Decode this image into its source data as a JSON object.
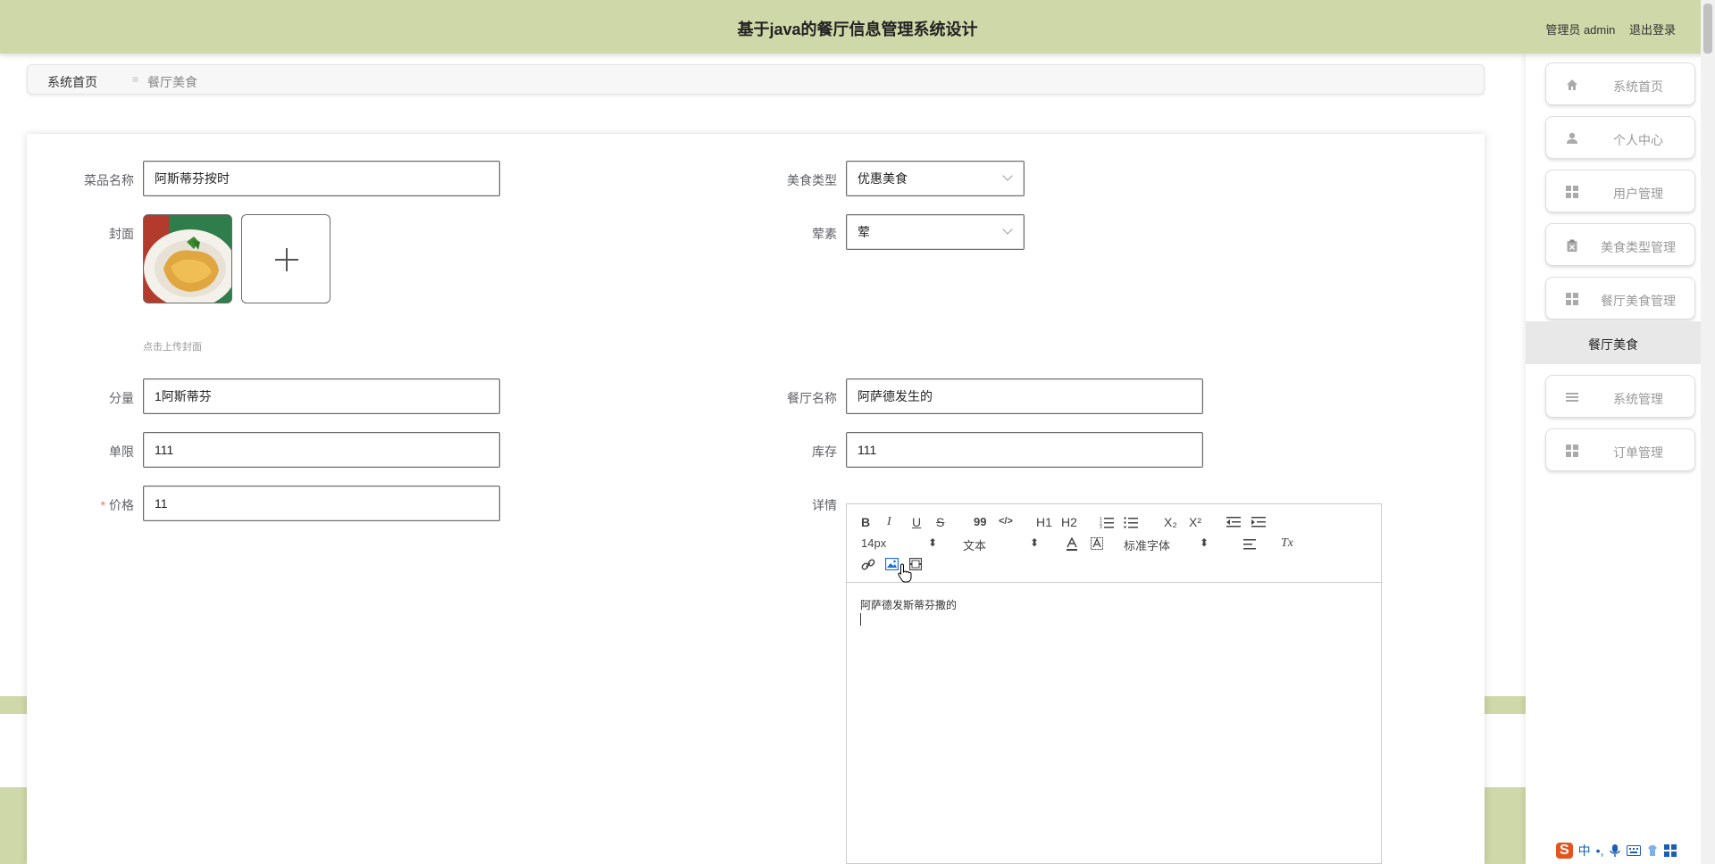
{
  "header": {
    "title": "基于java的餐厅信息管理系统设计",
    "user_label": "管理员 admin",
    "logout_label": "退出登录"
  },
  "breadcrumb": {
    "home": "系统首页",
    "separator": "≡",
    "current": "餐厅美食"
  },
  "form": {
    "dish_name": {
      "label": "菜品名称",
      "value": "阿斯蒂芬按时"
    },
    "food_type": {
      "label": "美食类型",
      "value": "优惠美食"
    },
    "cover": {
      "label": "封面",
      "hint": "点击上传封面"
    },
    "meat_veg": {
      "label": "荤素",
      "value": "荤"
    },
    "portion": {
      "label": "分量",
      "value": "1阿斯蒂芬"
    },
    "restaurant": {
      "label": "餐厅名称",
      "value": "阿萨德发生的"
    },
    "limit": {
      "label": "单限",
      "value": "111"
    },
    "stock": {
      "label": "库存",
      "value": "111"
    },
    "price": {
      "label": "价格",
      "required_mark": "*",
      "value": "11"
    },
    "detail": {
      "label": "详情",
      "content": "阿萨德发斯蒂芬撒的"
    }
  },
  "editor_toolbar": {
    "bold": "B",
    "italic": "I",
    "underline": "U",
    "strike": "S",
    "quote": "99",
    "code": "</>",
    "h1": "H1",
    "h2": "H2",
    "subscript": "X₂",
    "superscript": "X²",
    "font_size": "14px",
    "header_select": "文本",
    "font_family": "标准字体",
    "clear": "Tx",
    "spin": "⬍"
  },
  "sidebar": {
    "items": [
      {
        "label": "系统首页",
        "icon": "home-icon"
      },
      {
        "label": "个人中心",
        "icon": "user-icon"
      },
      {
        "label": "用户管理",
        "icon": "grid-icon"
      },
      {
        "label": "美食类型管理",
        "icon": "clipboard-icon"
      },
      {
        "label": "餐厅美食管理",
        "icon": "grid-icon"
      },
      {
        "label": "系统管理",
        "icon": "menu-icon"
      },
      {
        "label": "订单管理",
        "icon": "grid-icon"
      }
    ],
    "active": "餐厅美食"
  },
  "ime": {
    "logo": "S",
    "lang": "中",
    "punct": "•,"
  },
  "colors": {
    "header_bg": "#cfd8a8",
    "required": "#f56c6c",
    "ime_logo": "#e3541f"
  }
}
